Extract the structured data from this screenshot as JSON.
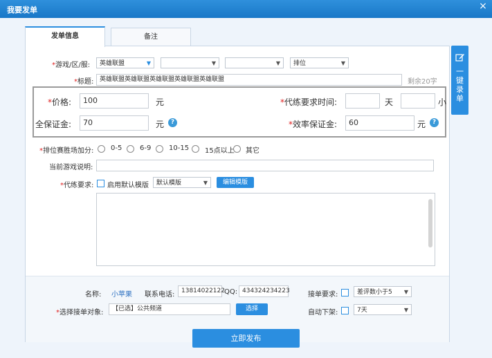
{
  "window": {
    "title": "我要发单",
    "close_glyph": "×"
  },
  "tabs": [
    {
      "label": "发单信息"
    },
    {
      "label": "备注"
    }
  ],
  "form": {
    "game_label": "游戏/区/服:",
    "game_value": "英雄联盟",
    "rank_value": "排位",
    "title_label": "标题:",
    "title_value": "英雄联盟英雄联盟英雄联盟英雄联盟英雄联盟",
    "title_remaining": "剩余20字",
    "price_label": "价格:",
    "price_value": "100",
    "price_unit": "元",
    "time_label": "代练要求时间:",
    "day_unit": "天",
    "hour_unit": "小",
    "deposit_label": "全保证金:",
    "deposit_value": "70",
    "deposit_unit": "元",
    "eff_label": "效率保证金:",
    "eff_value": "60",
    "eff_unit": "元",
    "help_glyph": "?",
    "bonus_label": "排位赛胜场加分:",
    "bonus_options": [
      "0-5",
      "6-9",
      "10-15",
      "15点以上",
      "其它"
    ],
    "desc_label": "当前游戏说明:",
    "req_label": "代练要求:",
    "use_template_label": "启用默认模版",
    "template_value": "默认模版",
    "edit_template_button": "编辑模版"
  },
  "contact": {
    "name_label": "名称:",
    "name_value": "小苹果",
    "phone_label": "联系电话:",
    "phone_value": "13814022122",
    "qq_label": "QQ:",
    "qq_value": "434324234223",
    "accept_label": "接单要求:",
    "accept_value": "差评数小于5",
    "target_label": "选择接单对象:",
    "target_value": "【已选】公共频道",
    "choose_button": "选择",
    "auto_off_label": "自动下架:",
    "auto_off_value": "7天"
  },
  "submit_button": "立即发布",
  "side_button": {
    "label": "一键录单",
    "icon": "edit-icon"
  },
  "colors": {
    "accent": "#2b8ee0",
    "title_bar": "#1877c7",
    "required": "#e02020"
  }
}
